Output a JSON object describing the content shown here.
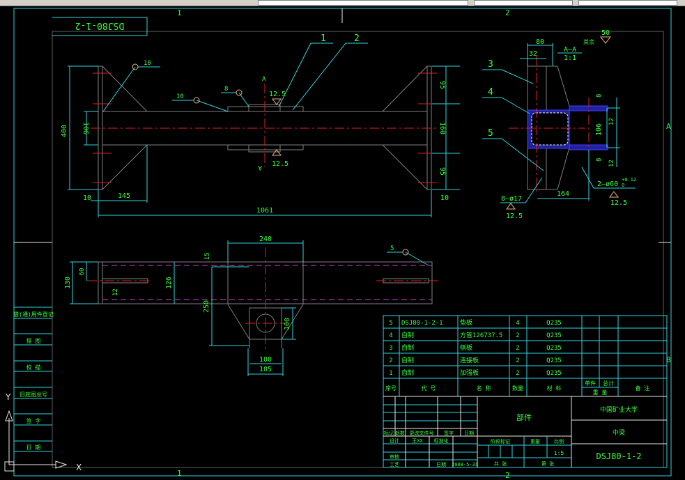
{
  "app": {
    "colors": {
      "background": "#000000",
      "frame": "#2fd6e0",
      "text": "#3bff3b",
      "centerline": "#e02020",
      "hidden": "#d040d0",
      "outline": "#808080"
    }
  },
  "frame": {
    "zones_top": [
      "1",
      "2"
    ],
    "zones_bottom": [
      "1",
      "2"
    ],
    "zones_right": [
      "A",
      "B"
    ]
  },
  "plaque": {
    "drawing_no_rotated": "DSJ80-1-2"
  },
  "left_strip": {
    "labels": [
      "借(通)用件登记",
      "描 图",
      "校 描",
      "旧底图总号",
      "签 字",
      "日 期"
    ]
  },
  "ucs": {
    "x_label": "X",
    "y_label": "Y",
    "icon": "ucs-icon"
  },
  "front_view": {
    "balloons": [
      "1",
      "2"
    ],
    "section_mark": "A",
    "dims": {
      "height": "400",
      "web": "106",
      "left_gap": "10",
      "gusset": "145",
      "length": "1061",
      "right_gap": "10",
      "top_r": "95",
      "mid_r": "160",
      "bot_r": "95"
    },
    "welds": [
      "10",
      "10",
      "8"
    ],
    "roughness": [
      "12.5",
      "12.5"
    ]
  },
  "section_view": {
    "title": "A—A",
    "scale": "1:1",
    "note": "其余",
    "roughness_other": "50",
    "balloons": [
      "3",
      "4",
      "5"
    ],
    "dims": {
      "width": "80",
      "offset": "32",
      "thk_top": "8",
      "h": "106",
      "s_top": "12",
      "thk_bot": "8",
      "s_bot": "12",
      "depth": "164"
    },
    "holes_small": "8—ø17",
    "holes_big": "2—ø60",
    "tol_upper": "+0.12",
    "tol_lower": "0",
    "roughness": [
      "12.5",
      "12.5"
    ]
  },
  "top_view": {
    "balloon": "5",
    "dims": {
      "h130": "130",
      "h60": "60",
      "h12": "12",
      "h126": "126",
      "w240": "240",
      "h15": "15",
      "h250": "250",
      "h100": "100",
      "w100": "100",
      "w105": "105"
    }
  },
  "parts_list": {
    "rows": [
      {
        "no": "5",
        "code": "DSJ80-1-2-1",
        "name": "垫板",
        "qty": "4",
        "material": "Q235"
      },
      {
        "no": "4",
        "code": "自制",
        "name": "方管126737.5",
        "qty": "2",
        "material": "Q235"
      },
      {
        "no": "3",
        "code": "自制",
        "name": "侧板",
        "qty": "2",
        "material": "Q235"
      },
      {
        "no": "2",
        "code": "自制",
        "name": "连接板",
        "qty": "2",
        "material": "Q235"
      },
      {
        "no": "1",
        "code": "自制",
        "name": "加强板",
        "qty": "2",
        "material": "Q235"
      }
    ],
    "headers": {
      "no": "序号",
      "code": "代 号",
      "name": "名 称",
      "qty": "数量",
      "material": "材 料",
      "unit": "单件",
      "total": "总计",
      "weight": "重 量",
      "remark": "备 注"
    }
  },
  "title_block": {
    "rev_labels": [
      "标记",
      "处数",
      "更改文件号",
      "签字",
      "日期"
    ],
    "design": "设计",
    "designer": "王XX",
    "standard": "标准化",
    "check": "审核",
    "process": "工艺",
    "date_label": "日期",
    "date": "2008-5-31",
    "part_name": "部件",
    "stage": "阶段标记",
    "weight": "重量",
    "scale_label": "比例",
    "scale": "1:5",
    "sheets_total": "共 张",
    "sheet_no": "第 张",
    "org": "中国矿业大学",
    "title": "中梁",
    "drawing_no": "DSJ80-1-2"
  }
}
